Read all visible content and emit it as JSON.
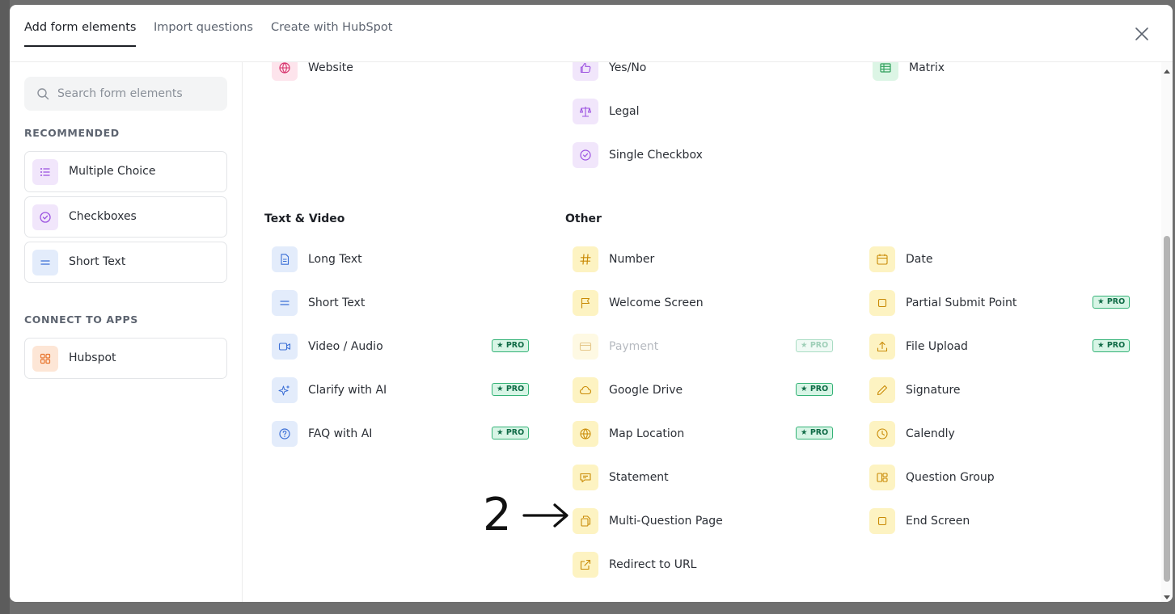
{
  "tabs": [
    {
      "label": "Add form elements",
      "active": true
    },
    {
      "label": "Import questions",
      "active": false
    },
    {
      "label": "Create with HubSpot",
      "active": false
    }
  ],
  "search": {
    "placeholder": "Search form elements"
  },
  "sidebar": {
    "recommended_label": "RECOMMENDED",
    "recommended": [
      {
        "label": "Multiple Choice",
        "icon": "list-icon",
        "color": "purple"
      },
      {
        "label": "Checkboxes",
        "icon": "check-circle-icon",
        "color": "purple"
      },
      {
        "label": "Short Text",
        "icon": "short-text-icon",
        "color": "blue"
      }
    ],
    "connect_label": "CONNECT TO APPS",
    "apps": [
      {
        "label": "Hubspot",
        "icon": "grid-icon",
        "color": "orange"
      }
    ]
  },
  "top_rows": {
    "col1": [
      {
        "label": "Website",
        "icon": "globe-icon",
        "color": "pink"
      }
    ],
    "col2": [
      {
        "label": "Yes/No",
        "icon": "thumbs-up-icon",
        "color": "purple"
      },
      {
        "label": "Legal",
        "icon": "scale-icon",
        "color": "purple"
      },
      {
        "label": "Single Checkbox",
        "icon": "check-circle-icon",
        "color": "purple"
      }
    ],
    "col3": [
      {
        "label": "Matrix",
        "icon": "table-icon",
        "color": "green"
      }
    ]
  },
  "sections": {
    "text_video": "Text & Video",
    "other": "Other"
  },
  "pro_badge": "★ PRO",
  "text_video_items": [
    {
      "label": "Long Text",
      "icon": "document-icon",
      "pro": false
    },
    {
      "label": "Short Text",
      "icon": "short-text-icon",
      "pro": false
    },
    {
      "label": "Video / Audio",
      "icon": "video-icon",
      "pro": true
    },
    {
      "label": "Clarify with AI",
      "icon": "sparkles-icon",
      "pro": true
    },
    {
      "label": "FAQ with AI",
      "icon": "question-icon",
      "pro": true
    }
  ],
  "other_col1": [
    {
      "label": "Number",
      "icon": "hash-icon",
      "pro": false
    },
    {
      "label": "Welcome Screen",
      "icon": "flag-icon",
      "pro": false
    },
    {
      "label": "Payment",
      "icon": "card-icon",
      "pro": true,
      "disabled": true
    },
    {
      "label": "Google Drive",
      "icon": "cloud-icon",
      "pro": true
    },
    {
      "label": "Map Location",
      "icon": "globe-icon",
      "pro": true
    },
    {
      "label": "Statement",
      "icon": "chat-icon",
      "pro": false
    },
    {
      "label": "Multi-Question Page",
      "icon": "pages-icon",
      "pro": false
    },
    {
      "label": "Redirect to URL",
      "icon": "external-link-icon",
      "pro": false
    }
  ],
  "other_col2": [
    {
      "label": "Date",
      "icon": "calendar-icon",
      "pro": false
    },
    {
      "label": "Partial Submit Point",
      "icon": "square-icon",
      "pro": true
    },
    {
      "label": "File Upload",
      "icon": "upload-icon",
      "pro": true
    },
    {
      "label": "Signature",
      "icon": "pen-icon",
      "pro": false
    },
    {
      "label": "Calendly",
      "icon": "clock-icon",
      "pro": false
    },
    {
      "label": "Question Group",
      "icon": "group-icon",
      "pro": false
    },
    {
      "label": "End Screen",
      "icon": "square-icon",
      "pro": false
    }
  ],
  "annotation": {
    "number": "2",
    "arrow": "→"
  },
  "colors": {
    "purple": "#f1e6fb",
    "blue": "#e3ecfb",
    "yellow": "#fdf3c2",
    "pink": "#fde4ec",
    "green": "#dcf5e5",
    "orange": "#fde6d6"
  }
}
